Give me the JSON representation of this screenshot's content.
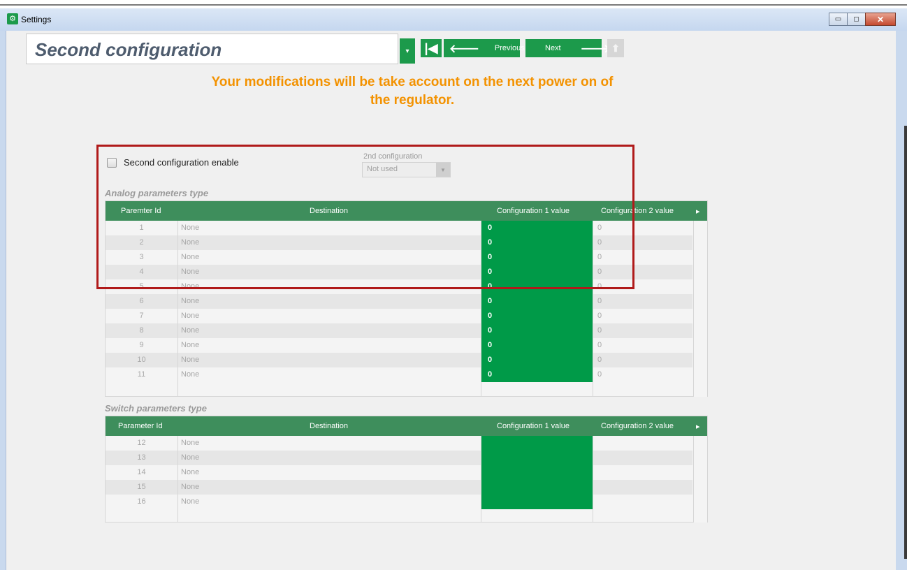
{
  "window": {
    "title": "Settings",
    "minimize": "▭",
    "maximize": "◻",
    "close": "✕"
  },
  "header": {
    "config_name": "Second configuration",
    "dropdown_glyph": "▾",
    "first_glyph": "⏮",
    "previous_label": "Previous",
    "previous_glyph": "🡐",
    "next_label": "Next",
    "next_glyph": "🡒",
    "up_glyph": "⬆"
  },
  "notice": {
    "line1": "Your modifications will be take account on the next power on of",
    "line2": "the regulator."
  },
  "controls": {
    "enable_label": "Second configuration enable",
    "enable_checked": false,
    "second_config_label": "2nd configuration",
    "second_config_value": "Not used",
    "second_config_arrow": "▼"
  },
  "analog": {
    "section_title": "Analog parameters type",
    "columns": [
      "Paremter Id",
      "Destination",
      "Configuration 1 value",
      "Configuration 2 value"
    ],
    "scroll_glyph": "▸",
    "rows": [
      {
        "id": "1",
        "dest": "None",
        "c1": "0",
        "c2": "0"
      },
      {
        "id": "2",
        "dest": "None",
        "c1": "0",
        "c2": "0"
      },
      {
        "id": "3",
        "dest": "None",
        "c1": "0",
        "c2": "0"
      },
      {
        "id": "4",
        "dest": "None",
        "c1": "0",
        "c2": "0"
      },
      {
        "id": "5",
        "dest": "None",
        "c1": "0",
        "c2": "0"
      },
      {
        "id": "6",
        "dest": "None",
        "c1": "0",
        "c2": "0"
      },
      {
        "id": "7",
        "dest": "None",
        "c1": "0",
        "c2": "0"
      },
      {
        "id": "8",
        "dest": "None",
        "c1": "0",
        "c2": "0"
      },
      {
        "id": "9",
        "dest": "None",
        "c1": "0",
        "c2": "0"
      },
      {
        "id": "10",
        "dest": "None",
        "c1": "0",
        "c2": "0"
      },
      {
        "id": "11",
        "dest": "None",
        "c1": "0",
        "c2": "0"
      }
    ]
  },
  "switch": {
    "section_title": "Switch parameters type",
    "columns": [
      "Parameter Id",
      "Destination",
      "Configuration 1 value",
      "Configuration 2 value"
    ],
    "scroll_glyph": "▸",
    "rows": [
      {
        "id": "12",
        "dest": "None",
        "c1": "",
        "c2": ""
      },
      {
        "id": "13",
        "dest": "None",
        "c1": "",
        "c2": ""
      },
      {
        "id": "14",
        "dest": "None",
        "c1": "",
        "c2": ""
      },
      {
        "id": "15",
        "dest": "None",
        "c1": "",
        "c2": ""
      },
      {
        "id": "16",
        "dest": "None",
        "c1": "",
        "c2": ""
      }
    ]
  },
  "colors": {
    "accent_green": "#009a48",
    "header_green": "#3e8e5c",
    "notice_orange": "#f39200",
    "highlight_red": "#b01a1a"
  }
}
